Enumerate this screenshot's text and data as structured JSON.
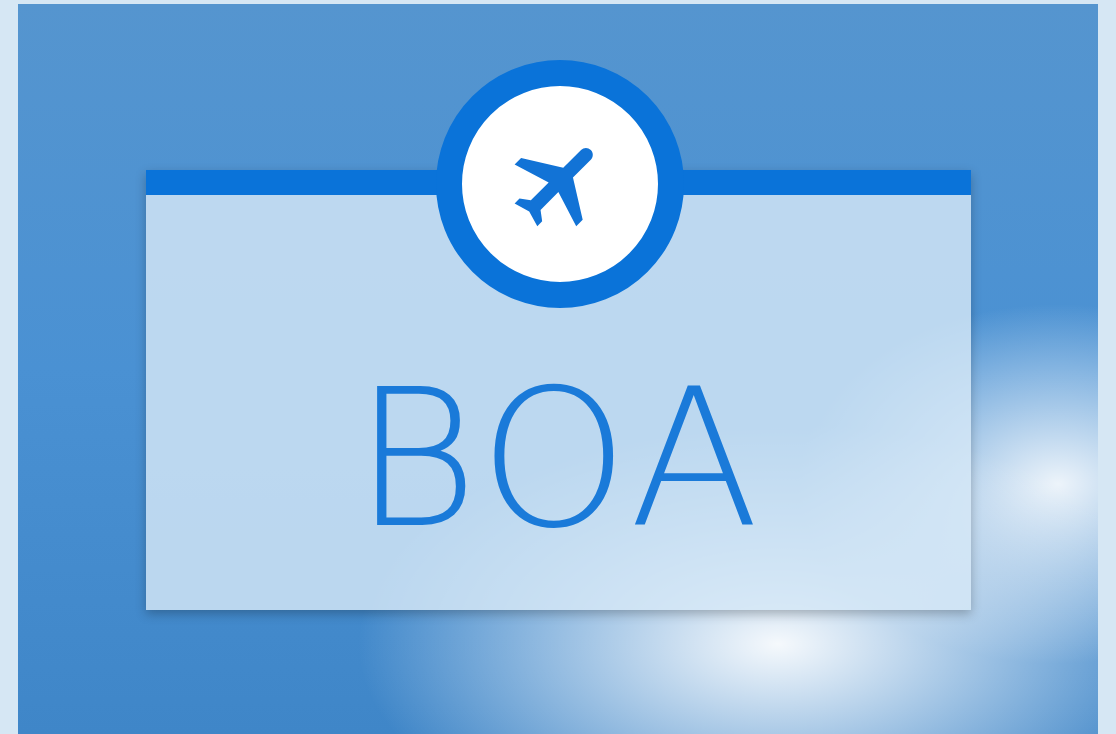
{
  "card": {
    "title": "BOA"
  }
}
